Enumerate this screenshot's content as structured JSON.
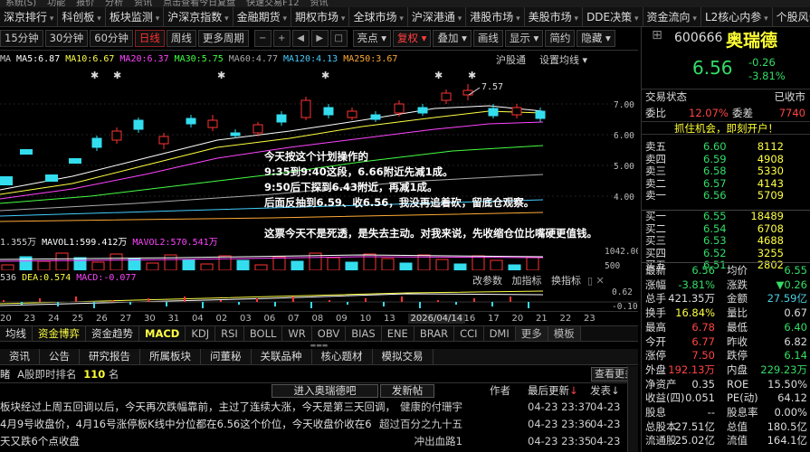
{
  "menubar": [
    "系统(S)",
    "功能",
    "报价",
    "分析",
    "资讯",
    "点击查看今日复盘",
    "快速交易F12",
    "资讯"
  ],
  "tabs": [
    "深京排行",
    "科创板",
    "板块监测",
    "沪深京指数",
    "金融期货",
    "期权市场",
    "全球市场",
    "沪深港通",
    "港股市场",
    "美股市场",
    "DDE决策",
    "资金流向",
    "L2核心内参",
    "个股风云"
  ],
  "toolbar": {
    "periods": [
      "15分钟",
      "30分钟",
      "60分钟",
      "日线",
      "周线",
      "更多周期"
    ],
    "right": [
      "亮点",
      "复权",
      "叠加",
      "画线",
      "显示",
      "简约",
      "隐藏"
    ]
  },
  "ma_line": [
    {
      "t": "MA",
      "c": "#cccccc"
    },
    {
      "t": "MA5:6.87",
      "c": "#ffffff"
    },
    {
      "t": "MA10:6.67",
      "c": "#ffff44"
    },
    {
      "t": "MA20:6.37",
      "c": "#ff44ff"
    },
    {
      "t": "MA30:5.75",
      "c": "#44ff44"
    },
    {
      "t": "MA60:4.77",
      "c": "#aaaaaa"
    },
    {
      "t": "MA120:4.13",
      "c": "#44ccff"
    },
    {
      "t": "MA250:3.67",
      "c": "#ffaa33"
    }
  ],
  "ma_right": [
    "沪股通",
    "设置均线"
  ],
  "price_axis": [
    "7.00",
    "6.00",
    "5.00",
    "4.00"
  ],
  "peak_label": "7.57",
  "annotation": [
    "今天按这个计划操作的",
    "9:35到9:40这段，6.66附近先减1成。",
    "9:50后下探到6.43附近，再减1成。",
    "后面反抽到6.59、收6.56，我没再追着砍，留底仓观察。",
    "这票今天不是死透，是失去主动。对我来说，先收缩仓位比嘴硬更值钱。"
  ],
  "vol_line": [
    {
      "t": "1.355万",
      "c": "#cccccc"
    },
    {
      "t": "MAVOL1:599.412万",
      "c": "#ffffff"
    },
    {
      "t": "MAVOL2:570.541万",
      "c": "#ff44ff"
    }
  ],
  "vol_axis": [
    "1042.00",
    "500"
  ],
  "dea_line": [
    {
      "t": "536",
      "c": "#cccccc"
    },
    {
      "t": "DEA:0.574",
      "c": "#ffff44"
    },
    {
      "t": "MACD:-0.077",
      "c": "#ff44ff"
    }
  ],
  "dea_buttons": [
    "改参数",
    "加指标",
    "换指标"
  ],
  "dea_axis": [
    "0.62",
    "-0.10"
  ],
  "dates": [
    "20",
    "23",
    "24",
    "25",
    "26",
    "27",
    "30",
    "31",
    "04",
    "02",
    "03",
    "06",
    "07",
    "08",
    "09",
    "10",
    "13",
    "2026/04/14",
    "16",
    "17",
    "20",
    "21",
    "22",
    "23"
  ],
  "ind_tabs": [
    "均线",
    "资金博弈",
    "资金趋势",
    "MACD",
    "KDJ",
    "RSI",
    "BOLL",
    "WR",
    "OBV",
    "BIAS",
    "ENE",
    "BRAR",
    "CCI",
    "DMI",
    "更多",
    "模板"
  ],
  "info_tabs": [
    "资讯",
    "公告",
    "研究报告",
    "所属板块",
    "问董秘",
    "关联品种",
    "核心题材",
    "模拟交易"
  ],
  "news_header": {
    "left": "睹",
    "rank_label": "A股即时排名",
    "rank": "110",
    "rank_unit": "名",
    "btn_enter": "进入奥瑞德吧",
    "btn_post": "发新帖",
    "col_author": "作者",
    "col_latest": "最后更新",
    "col_post": "发表",
    "view_more": "查看更多"
  },
  "news": [
    {
      "title": "板块经过上周五回调以后，今天再次跌幅靠前，主过了连续大涨，今天是第三天回调，",
      "author": "健康的付珊宇",
      "upd": "04-23 23:37",
      "pub": "04-23"
    },
    {
      "title": "4月9号收盘价，4月16号涨停板K线中分位都在6.56这个价位，今天收盘价收在6",
      "author": "超过百分之九十五",
      "upd": "04-23 23:36",
      "pub": "04-23"
    },
    {
      "title": "天又跌6个点收盘",
      "author": "冲出血路1",
      "upd": "04-23 23:35",
      "pub": "04-23"
    }
  ],
  "stock": {
    "code": "600666",
    "name": "奥瑞德",
    "price": "6.56",
    "chg": "-0.26",
    "pct": "-3.81%",
    "status_label": "交易状态",
    "status": "已收市",
    "weibi_label": "委比",
    "weibi": "12.07%",
    "weicha_label": "委差",
    "weicha": "7740",
    "promo": "抓住机会，即刻开户！"
  },
  "asks": [
    {
      "l": "卖五",
      "p": "6.60",
      "v": "8112"
    },
    {
      "l": "卖四",
      "p": "6.59",
      "v": "4908"
    },
    {
      "l": "卖三",
      "p": "6.58",
      "v": "5330"
    },
    {
      "l": "卖二",
      "p": "6.57",
      "v": "4143"
    },
    {
      "l": "卖一",
      "p": "6.56",
      "v": "5709"
    }
  ],
  "bids": [
    {
      "l": "买一",
      "p": "6.55",
      "v": "18489"
    },
    {
      "l": "买二",
      "p": "6.54",
      "v": "6708"
    },
    {
      "l": "买三",
      "p": "6.53",
      "v": "4688"
    },
    {
      "l": "买四",
      "p": "6.52",
      "v": "3255"
    },
    {
      "l": "买五",
      "p": "6.51",
      "v": "2802"
    }
  ],
  "stats": [
    {
      "l1": "最新",
      "v1": "6.56",
      "c1": "green",
      "l2": "均价",
      "v2": "6.55",
      "c2": "green"
    },
    {
      "l1": "涨幅",
      "v1": "-3.81%",
      "c1": "green",
      "l2": "涨跌",
      "v2": "▼0.26",
      "c2": "green"
    },
    {
      "l1": "总手",
      "v1": "421.35万",
      "c1": "white",
      "l2": "金额",
      "v2": "27.59亿",
      "c2": "cyan"
    },
    {
      "l1": "换手",
      "v1": "16.84%",
      "c1": "yellow",
      "l2": "量比",
      "v2": "0.67",
      "c2": "white"
    },
    {
      "l1": "最高",
      "v1": "6.78",
      "c1": "red",
      "l2": "最低",
      "v2": "6.40",
      "c2": "green"
    },
    {
      "l1": "今开",
      "v1": "6.77",
      "c1": "red",
      "l2": "昨收",
      "v2": "6.82",
      "c2": "white"
    },
    {
      "l1": "涨停",
      "v1": "7.50",
      "c1": "red",
      "l2": "跌停",
      "v2": "6.14",
      "c2": "green"
    },
    {
      "l1": "外盘",
      "v1": "192.13万",
      "c1": "red",
      "l2": "内盘",
      "v2": "229.23万",
      "c2": "green"
    },
    {
      "l1": "净资产",
      "v1": "0.35",
      "c1": "white",
      "l2": "ROE",
      "v2": "15.50%",
      "c2": "white"
    },
    {
      "l1": "收益(四)",
      "v1": "0.051",
      "c1": "white",
      "l2": "PE(动)",
      "v2": "64.12",
      "c2": "white"
    },
    {
      "l1": "股息",
      "v1": "--",
      "c1": "white",
      "l2": "股息率",
      "v2": "0.00%",
      "c2": "white"
    },
    {
      "l1": "总股本",
      "v1": "27.51亿",
      "c1": "white",
      "l2": "总值",
      "v2": "180.5亿",
      "c2": "white"
    },
    {
      "l1": "流通股",
      "v1": "25.02亿",
      "c1": "white",
      "l2": "流值",
      "v2": "164.1亿",
      "c2": "white"
    }
  ]
}
